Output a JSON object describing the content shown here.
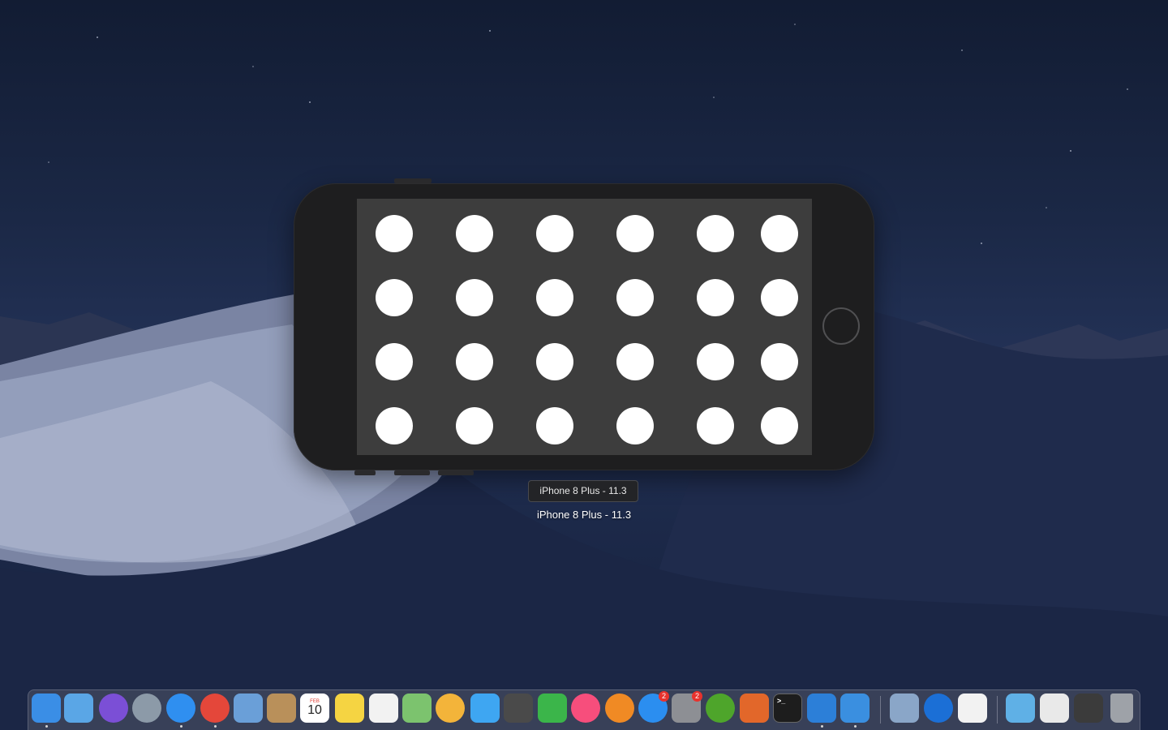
{
  "simulator": {
    "device_tooltip": "iPhone 8 Plus - 11.3",
    "device_label": "iPhone 8 Plus - 11.3"
  },
  "dock": {
    "items": [
      {
        "name": "finder-icon",
        "color": "#3a8ee6"
      },
      {
        "name": "folder-icon",
        "color": "#5aa6e6"
      },
      {
        "name": "siri-icon",
        "color": "#7b4fd6"
      },
      {
        "name": "launchpad-icon",
        "color": "#8c9aa8"
      },
      {
        "name": "safari-icon",
        "color": "#2f8ff0"
      },
      {
        "name": "chrome-icon",
        "color": "#e4473a"
      },
      {
        "name": "mail-icon",
        "color": "#6a9fd8"
      },
      {
        "name": "contacts-icon",
        "color": "#b9905a"
      },
      {
        "name": "calendar-icon",
        "color": "#ffffff",
        "month": "FEB",
        "day": "10"
      },
      {
        "name": "notes-icon",
        "color": "#f5d442"
      },
      {
        "name": "reminders-icon",
        "color": "#f2f2f2"
      },
      {
        "name": "maps-icon",
        "color": "#7cc36e"
      },
      {
        "name": "photos-icon",
        "color": "#f3b43a"
      },
      {
        "name": "messages-icon",
        "color": "#3ea6f2"
      },
      {
        "name": "sublime-text-icon",
        "color": "#4a4a4a"
      },
      {
        "name": "facetime-icon",
        "color": "#3bb54a"
      },
      {
        "name": "itunes-icon",
        "color": "#f74e7c"
      },
      {
        "name": "ibooks-icon",
        "color": "#f08a24"
      },
      {
        "name": "app-store-icon",
        "color": "#2b8ef0",
        "badge": "2"
      },
      {
        "name": "system-preferences-icon",
        "color": "#8d8f94",
        "badge": "2"
      },
      {
        "name": "utorrent-icon",
        "color": "#4ea52b"
      },
      {
        "name": "matlab-icon",
        "color": "#e2672a"
      },
      {
        "name": "terminal-icon",
        "color": "#1d1d1d"
      },
      {
        "name": "xcode-icon",
        "color": "#2c7fd8"
      },
      {
        "name": "simulator-icon",
        "color": "#3a8fe0"
      },
      {
        "name": "preview-icon",
        "color": "#8aa6c8"
      },
      {
        "name": "teamviewer-icon",
        "color": "#1b6fd6"
      },
      {
        "name": "textedit-icon",
        "color": "#f2f2f2"
      },
      {
        "name": "downloads-folder-icon",
        "color": "#5fb0e6"
      },
      {
        "name": "chrome-document-icon",
        "color": "#e9e9e9"
      },
      {
        "name": "screenshot-stack-icon",
        "color": "#3b3b3b"
      },
      {
        "name": "trash-icon",
        "color": "#9ea2a8"
      }
    ]
  }
}
